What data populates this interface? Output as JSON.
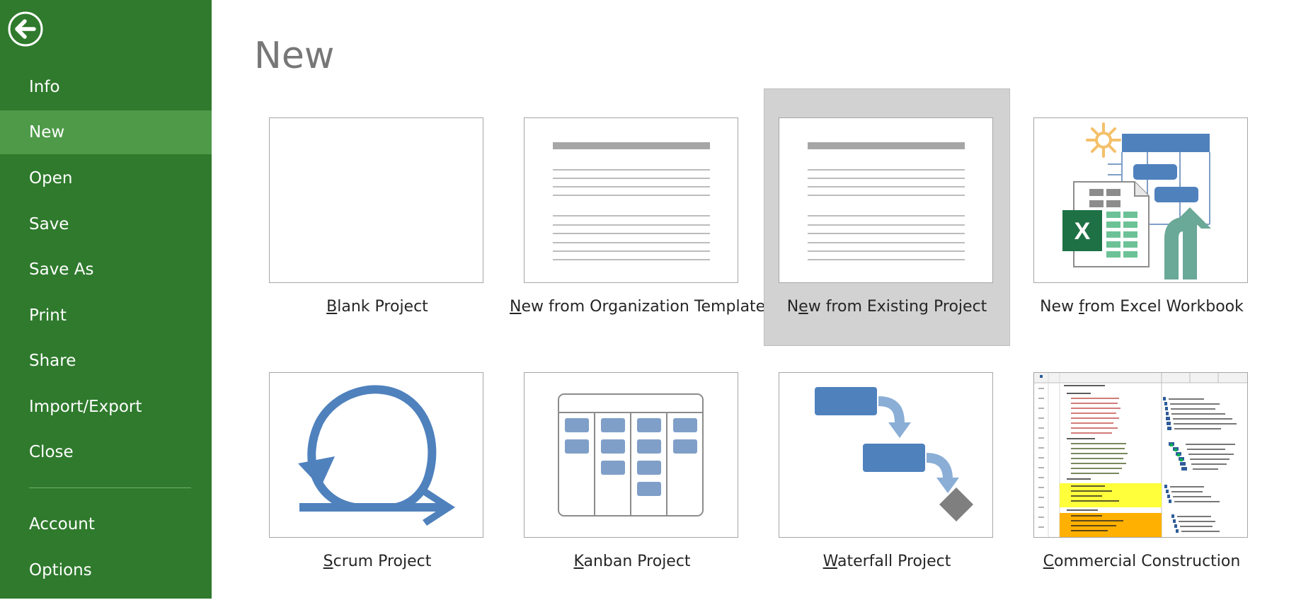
{
  "sidebar": {
    "back_icon": "back-arrow-icon",
    "items": [
      {
        "id": "info",
        "label": "Info"
      },
      {
        "id": "new",
        "label": "New",
        "active": true
      },
      {
        "id": "open",
        "label": "Open"
      },
      {
        "id": "save",
        "label": "Save"
      },
      {
        "id": "save-as",
        "label": "Save As"
      },
      {
        "id": "print",
        "label": "Print"
      },
      {
        "id": "share",
        "label": "Share"
      },
      {
        "id": "import-export",
        "label": "Import/Export"
      },
      {
        "id": "close",
        "label": "Close"
      }
    ],
    "bottom_items": [
      {
        "id": "account",
        "label": "Account"
      },
      {
        "id": "options",
        "label": "Options"
      }
    ],
    "colors": {
      "background": "#2f7a2d",
      "active": "#4e9a48"
    }
  },
  "main": {
    "title": "New",
    "templates": [
      {
        "id": "blank",
        "pre": "",
        "key": "B",
        "post": "lank Project",
        "icon": "blank-page-icon"
      },
      {
        "id": "org-template",
        "pre": "",
        "key": "N",
        "post": "ew from Organization Template",
        "icon": "document-lines-icon"
      },
      {
        "id": "existing",
        "pre": "N",
        "key": "e",
        "post": "w from Existing Project",
        "icon": "document-lines-icon",
        "selected": true
      },
      {
        "id": "excel",
        "pre": "New ",
        "key": "f",
        "post": "rom Excel Workbook",
        "icon": "excel-import-icon"
      },
      {
        "id": "scrum",
        "pre": "",
        "key": "S",
        "post": "crum Project",
        "icon": "scrum-cycle-icon"
      },
      {
        "id": "kanban",
        "pre": "",
        "key": "K",
        "post": "anban Project",
        "icon": "kanban-board-icon"
      },
      {
        "id": "waterfall",
        "pre": "",
        "key": "W",
        "post": "aterfall Project",
        "icon": "waterfall-gantt-icon"
      },
      {
        "id": "construction",
        "pre": "",
        "key": "C",
        "post": "ommercial Construction",
        "icon": "gantt-schedule-icon"
      }
    ],
    "colors": {
      "accent_blue": "#4f81bd",
      "excel_green": "#1e7145",
      "teal_arrow": "#6aa898",
      "sun": "#f4c06a"
    }
  }
}
